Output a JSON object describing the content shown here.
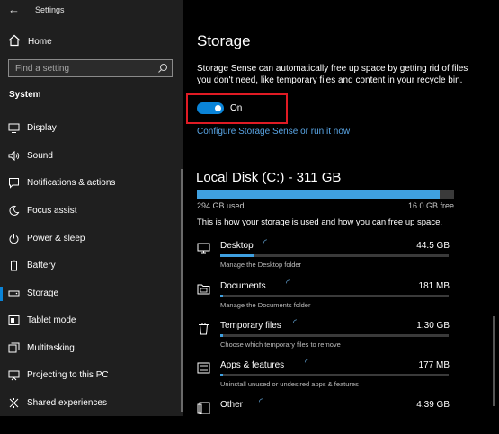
{
  "window": {
    "title": "Settings"
  },
  "sidebar": {
    "home_label": "Home",
    "search_placeholder": "Find a setting",
    "section": "System",
    "items": [
      {
        "label": "Display",
        "icon": "display-icon",
        "selected": false
      },
      {
        "label": "Sound",
        "icon": "speaker-icon",
        "selected": false
      },
      {
        "label": "Notifications & actions",
        "icon": "notification-icon",
        "selected": false
      },
      {
        "label": "Focus assist",
        "icon": "moon-icon",
        "selected": false
      },
      {
        "label": "Power & sleep",
        "icon": "power-icon",
        "selected": false
      },
      {
        "label": "Battery",
        "icon": "battery-icon",
        "selected": false
      },
      {
        "label": "Storage",
        "icon": "storage-icon",
        "selected": true
      },
      {
        "label": "Tablet mode",
        "icon": "tablet-icon",
        "selected": false
      },
      {
        "label": "Multitasking",
        "icon": "multitasking-icon",
        "selected": false
      },
      {
        "label": "Projecting to this PC",
        "icon": "projector-icon",
        "selected": false
      },
      {
        "label": "Shared experiences",
        "icon": "shared-icon",
        "selected": false
      }
    ]
  },
  "main": {
    "title": "Storage",
    "description": "Storage Sense can automatically free up space by getting rid of files you don't need, like temporary files and content in your recycle bin.",
    "toggle": {
      "state_label": "On",
      "on": true
    },
    "configure_link": "Configure Storage Sense or run it now",
    "disk": {
      "title": "Local Disk (C:) - 311 GB",
      "used": "294 GB used",
      "free": "16.0 GB free",
      "used_fraction": 0.945,
      "usage_description": "This is how your storage is used and how you can free up space."
    },
    "categories": [
      {
        "name": "Desktop",
        "size": "44.5 GB",
        "sub": "Manage the Desktop folder",
        "icon": "monitor-icon",
        "fraction": 0.15
      },
      {
        "name": "Documents",
        "size": "181 MB",
        "sub": "Manage the Documents folder",
        "icon": "folder-icon",
        "fraction": 0.01
      },
      {
        "name": "Temporary files",
        "size": "1.30 GB",
        "sub": "Choose which temporary files to remove",
        "icon": "trash-icon",
        "fraction": 0.01
      },
      {
        "name": "Apps & features",
        "size": "177 MB",
        "sub": "Uninstall unused or undesired apps & features",
        "icon": "apps-icon",
        "fraction": 0.01
      },
      {
        "name": "Other",
        "size": "4.39 GB",
        "sub": "",
        "icon": "other-icon",
        "fraction": 0.02
      }
    ]
  },
  "colors": {
    "accent": "#0a84d8",
    "highlight": "#e01b24",
    "link": "#5aa6e6"
  }
}
